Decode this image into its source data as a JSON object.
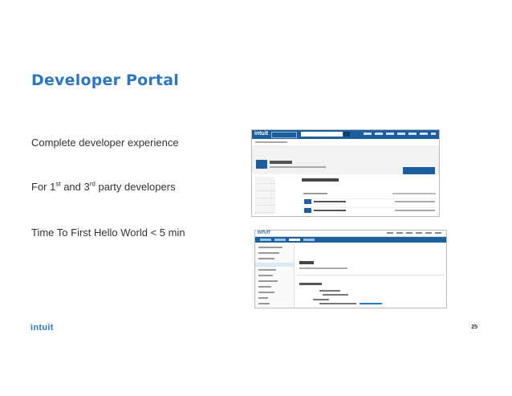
{
  "slide": {
    "title": "Developer Portal",
    "bullets": [
      {
        "pre": "Complete developer experience"
      },
      {
        "pre": "For 1",
        "sup1": "st",
        "mid": " and 3",
        "sup2": "rd",
        "post": " party developers"
      },
      {
        "pre": "Time To First Hello World < 5 min"
      }
    ],
    "logo": "intuit",
    "page_number": "25"
  },
  "screenshot1": {
    "brand": "intuit"
  },
  "screenshot2": {
    "brand": "INTUIT"
  },
  "colors": {
    "title": "#2b78c2",
    "brand_blue": "#1d5f9e",
    "text": "#333333"
  }
}
